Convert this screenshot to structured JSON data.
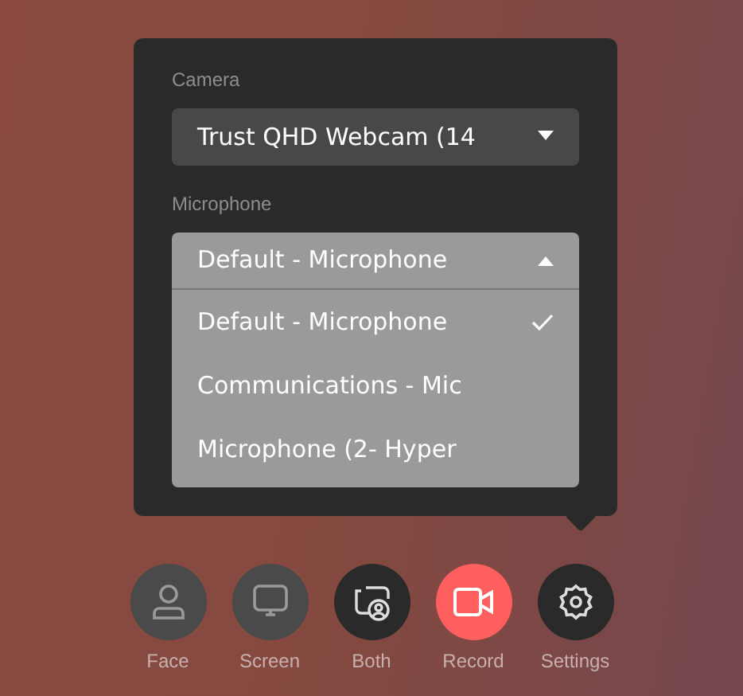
{
  "settings_panel": {
    "camera": {
      "label": "Camera",
      "value": "Trust QHD Webcam (14",
      "expanded": false
    },
    "microphone": {
      "label": "Microphone",
      "value": "Default - Microphone",
      "expanded": true,
      "options": [
        {
          "label": "Default - Microphone",
          "selected": true
        },
        {
          "label": "Communications - Mic",
          "selected": false
        },
        {
          "label": "Microphone (2- Hyper",
          "selected": false
        }
      ]
    }
  },
  "controls": [
    {
      "kind": "face",
      "label": "Face",
      "selected": false
    },
    {
      "kind": "screen",
      "label": "Screen",
      "selected": false
    },
    {
      "kind": "both",
      "label": "Both",
      "selected": true
    },
    {
      "kind": "record",
      "label": "Record"
    },
    {
      "kind": "settings",
      "label": "Settings",
      "expanded": true
    }
  ]
}
